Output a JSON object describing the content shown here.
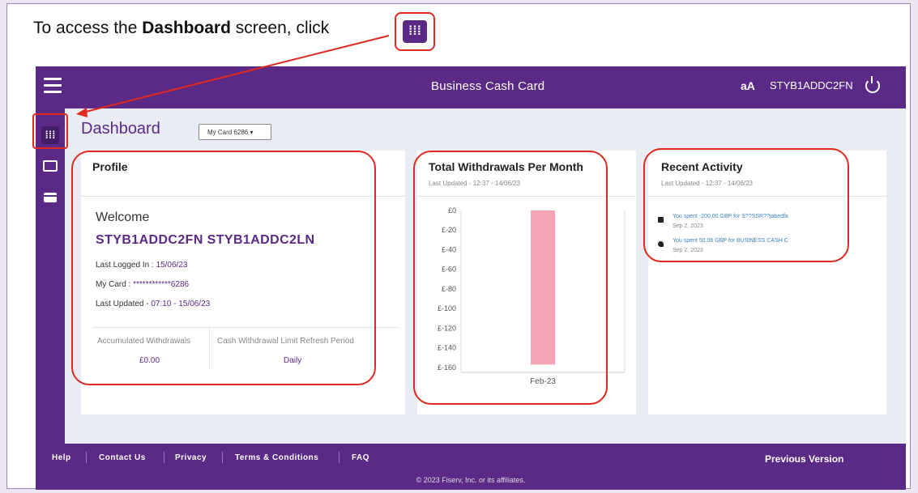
{
  "instruction": {
    "prefix": "To access the ",
    "bold": "Dashboard",
    "suffix": " screen, click",
    "icon_glyph": "⁞⁞⁞"
  },
  "header": {
    "app_title": "Business Cash Card",
    "font_toggle": "aA",
    "username": "STYB1ADDC2FN"
  },
  "page": {
    "title": "Dashboard",
    "card_select": "My Card 6286 ▾"
  },
  "profile": {
    "title": "Profile",
    "welcome": "Welcome",
    "fullname": "STYB1ADDC2FN STYB1ADDC2LN",
    "last_logged_label": "Last Logged In : ",
    "last_logged_value": "15/06/23",
    "card_label": "My Card : ",
    "card_value": "************6286",
    "last_updated_label": "Last Updated - ",
    "last_updated_value": "07:10 - 15/06/23",
    "stat1_label": "Accumulated Withdrawals",
    "stat1_value": "£0.00",
    "stat2_label": "Cash Withdrawal Limit Refresh Period",
    "stat2_value": "Daily"
  },
  "withdrawals": {
    "title": "Total Withdrawals Per Month",
    "subtitle": "Last Updated - 12:37 - 14/06/23"
  },
  "chart_data": {
    "type": "bar",
    "title": "Total Withdrawals Per Month",
    "categories": [
      "Feb-23"
    ],
    "values": [
      -157
    ],
    "ylim": [
      -165,
      0
    ],
    "y_ticks": [
      "£0",
      "£-20",
      "£-40",
      "£-60",
      "£-80",
      "£-100",
      "£-120",
      "£-140",
      "£-160"
    ],
    "y_tick_values": [
      0,
      -20,
      -40,
      -60,
      -80,
      -100,
      -120,
      -140,
      -160
    ],
    "xlabel": "",
    "ylabel": "",
    "color": "#f5a3b5",
    "grid": false
  },
  "activity": {
    "title": "Recent Activity",
    "subtitle": "Last Updated - 12:37 - 14/06/23",
    "items": [
      {
        "text": "You spent  -200.00 GBP  for  S??SSR??jabedfa",
        "date": "Sep 2, 2023"
      },
      {
        "text": "You spent  50.06 GBP  for  BUSINESS CASH C",
        "date": "Sep 2, 2023"
      }
    ]
  },
  "footer": {
    "links": [
      "Help",
      "Contact Us",
      "Privacy",
      "Terms & Conditions",
      "FAQ"
    ],
    "previous_version": "Previous Version",
    "copyright": "© 2023 Fiserv, Inc. or its affiliates."
  },
  "colors": {
    "brand": "#5b2a86",
    "annotation": "#e0281e",
    "bar": "#f5a3b5"
  }
}
